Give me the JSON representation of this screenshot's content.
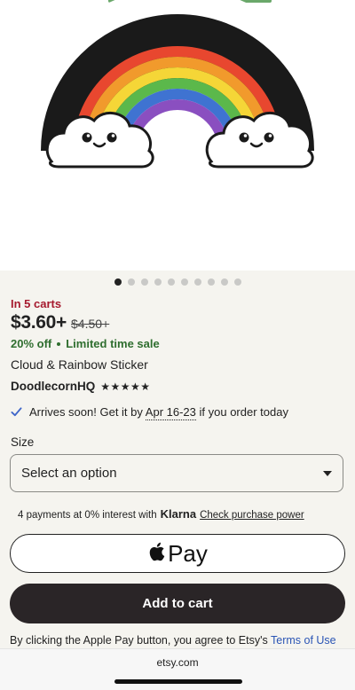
{
  "product": {
    "carts_badge": "In 5 carts",
    "price": "$3.60+",
    "original_price": "$4.50+",
    "discount": "20% off",
    "sale_label": "Limited time sale",
    "title": "Cloud & Rainbow Sticker",
    "shop_name": "DoodlecornHQ",
    "rating": 5,
    "stars": "★★★★★"
  },
  "gallery": {
    "image_count": 10,
    "active_index": 0
  },
  "shipping": {
    "text_before": "Arrives soon! Get it by",
    "date": "Apr 16-23",
    "text_after": "if you order today"
  },
  "size": {
    "label": "Size",
    "placeholder": "Select an option"
  },
  "klarna": {
    "text": "4 payments at 0% interest with",
    "brand": "Klarna",
    "link": "Check purchase power"
  },
  "buttons": {
    "apple_pay_label": "Pay",
    "add_to_cart_label": "Add to cart"
  },
  "legal": {
    "text": "By clicking the Apple Pay button, you agree to Etsy's",
    "link": "Terms of Use"
  },
  "browser": {
    "url": "etsy.com"
  },
  "colors": {
    "sale_red": "#a61a2e",
    "discount_green": "#2f6e2f",
    "link_blue": "#2b55b5",
    "cart_button": "#2a2527"
  }
}
